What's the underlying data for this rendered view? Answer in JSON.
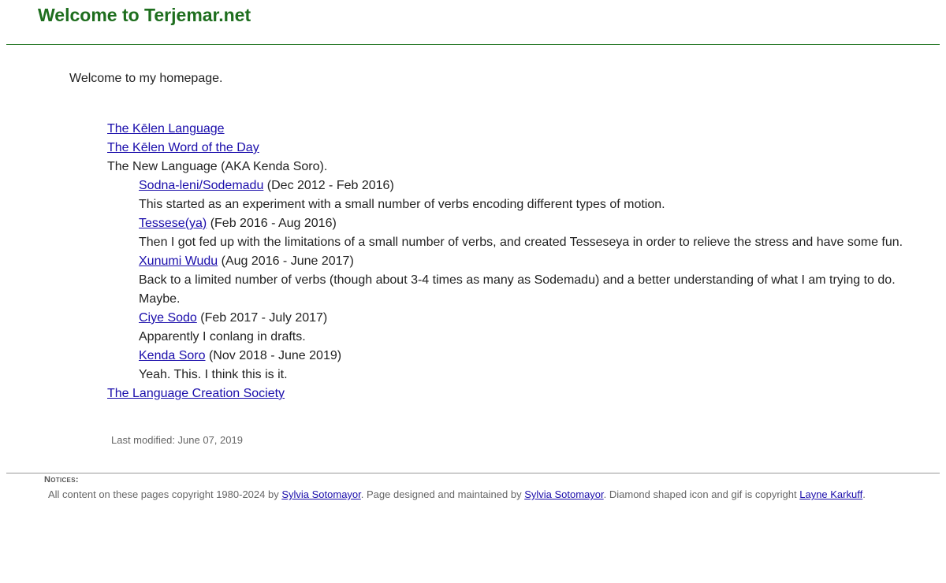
{
  "header": {
    "title": "Welcome to Terjemar.net"
  },
  "intro": "Welcome to my homepage.",
  "nav": {
    "kelen_language": "The Kēlen Language",
    "kelen_word": "The Kēlen Word of the Day",
    "new_language": "The New Language (AKA Kenda Soro).",
    "projects": [
      {
        "name": "Sodna-leni/Sodemadu",
        "dates": " (Dec 2012 - Feb 2016)",
        "notes": [
          "This started as an experiment with a small number of verbs encoding different types of motion."
        ]
      },
      {
        "name": "Tessese(ya)",
        "dates": " (Feb 2016 - Aug 2016)",
        "notes": [
          "Then I got fed up with the limitations of a small number of verbs, and created Tesseseya in order to relieve the stress and have some fun."
        ]
      },
      {
        "name": "Xunumi Wudu",
        "dates": " (Aug 2016 - June 2017)",
        "notes": [
          "Back to a limited number of verbs (though about 3-4 times as many as Sodemadu) and a better understanding of what I am trying to do.",
          "Maybe."
        ]
      },
      {
        "name": "Ciye Sodo",
        "dates": " (Feb 2017 - July 2017)",
        "notes": [
          "Apparently I conlang in drafts."
        ]
      },
      {
        "name": "Kenda Soro",
        "dates": " (Nov 2018 - June 2019)",
        "notes": [
          "Yeah. This. I think this is it."
        ]
      }
    ],
    "lcs": "The Language Creation Society"
  },
  "last_modified": "Last modified: June 07, 2019",
  "notices": {
    "heading": "Notices:",
    "text_1": "All content on these pages copyright 1980-2024 by ",
    "author_link_1": "Sylvia Sotomayor",
    "text_2": ". Page designed and maintained by ",
    "author_link_2": "Sylvia Sotomayor",
    "text_3": ". Diamond shaped icon and gif is copyright ",
    "icon_author_link": "Layne Karkuff",
    "text_4": "."
  }
}
